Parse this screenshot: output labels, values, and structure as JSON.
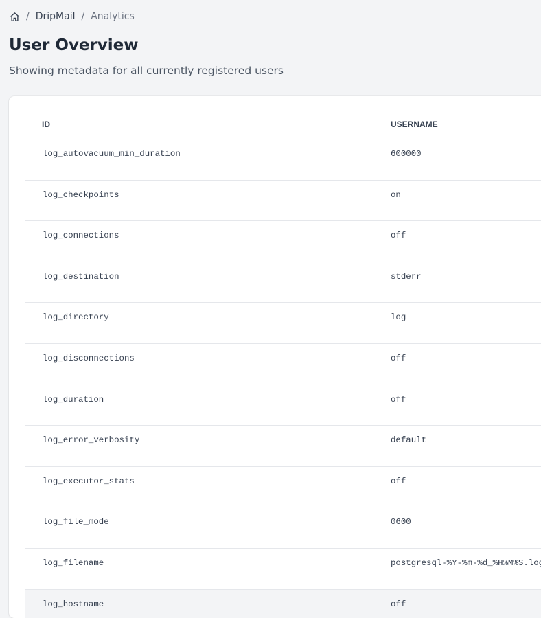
{
  "breadcrumb": {
    "home_icon": "home-icon",
    "separator": "/",
    "items": [
      "DripMail",
      "Analytics"
    ]
  },
  "page": {
    "title": "User Overview",
    "subtitle": "Showing metadata for all currently registered users"
  },
  "table": {
    "columns": [
      "ID",
      "USERNAME"
    ],
    "rows": [
      {
        "id": "log_autovacuum_min_duration",
        "username": "600000"
      },
      {
        "id": "log_checkpoints",
        "username": "on"
      },
      {
        "id": "log_connections",
        "username": "off"
      },
      {
        "id": "log_destination",
        "username": "stderr"
      },
      {
        "id": "log_directory",
        "username": "log"
      },
      {
        "id": "log_disconnections",
        "username": "off"
      },
      {
        "id": "log_duration",
        "username": "off"
      },
      {
        "id": "log_error_verbosity",
        "username": "default"
      },
      {
        "id": "log_executor_stats",
        "username": "off"
      },
      {
        "id": "log_file_mode",
        "username": "0600"
      },
      {
        "id": "log_filename",
        "username": "postgresql-%Y-%m-%d_%H%M%S.log"
      },
      {
        "id": "log_hostname",
        "username": "off"
      }
    ]
  },
  "colors": {
    "background": "#f3f4f6",
    "card": "#ffffff",
    "border": "#e5e7eb",
    "text": "#1f2937",
    "muted": "#6b7280",
    "row_hover": "#f3f4f6"
  }
}
